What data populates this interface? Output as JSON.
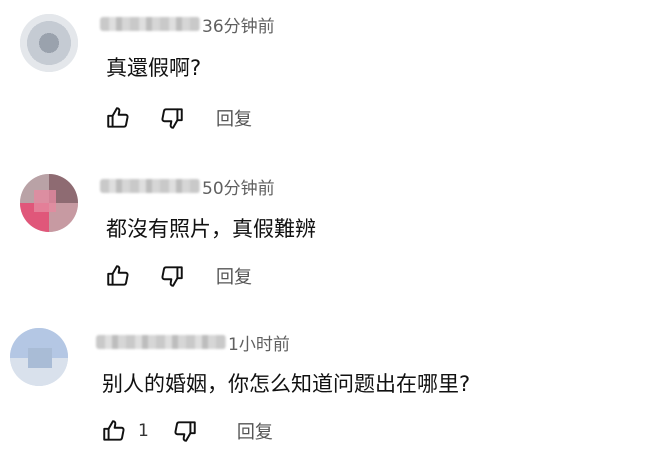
{
  "comments": [
    {
      "time": "36分钟前",
      "text": "真還假啊?",
      "like_count": "",
      "reply_label": "回复"
    },
    {
      "time": "50分钟前",
      "text": "都沒有照片，真假難辨",
      "like_count": "",
      "reply_label": "回复"
    },
    {
      "time": "1小时前",
      "text": "别人的婚姻，你怎么知道问题出在哪里?",
      "like_count": "1",
      "reply_label": "回复"
    }
  ],
  "icons": {
    "like": "thumbs-up-icon",
    "dislike": "thumbs-down-icon"
  },
  "colors": {
    "text": "#0f0f0f",
    "meta": "#606060",
    "reply": "#555555"
  }
}
